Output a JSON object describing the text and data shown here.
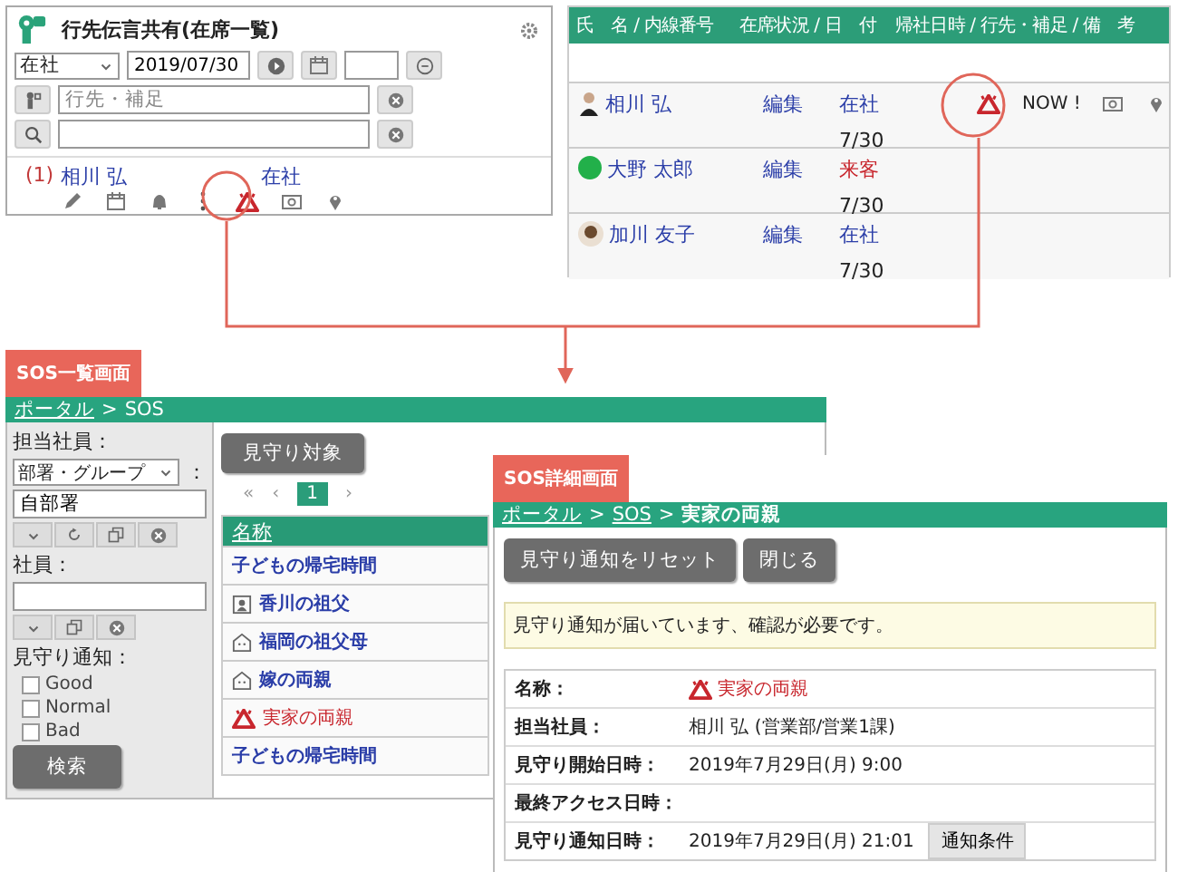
{
  "presence_widget": {
    "title": "行先伝言共有(在席一覧)",
    "status_select": "在社",
    "date": "2019/07/30",
    "note_placeholder": "行先・補足",
    "entry": {
      "count": "(1)",
      "name": "相川 弘",
      "status": "在社"
    }
  },
  "presence_table": {
    "columns": [
      "氏　名 / 内線番号",
      "在席状況 / 日　付",
      "帰社日時 / 行先・補足 / 備　考"
    ],
    "rows": [
      {
        "name": "相川 弘",
        "avatar": {
          "kind": "suit"
        },
        "edit": "編集",
        "status": "在社",
        "kind": "present",
        "date": "7/30",
        "alert": true,
        "note": "NOW !"
      },
      {
        "name": "大野 太郎",
        "avatar": {
          "kind": "dot",
          "color": "#22b04a"
        },
        "edit": "編集",
        "status": "来客",
        "kind": "visitor",
        "date": "7/30",
        "alert": false
      },
      {
        "name": "加川 友子",
        "avatar": {
          "kind": "face"
        },
        "edit": "編集",
        "status": "在社",
        "kind": "present",
        "date": "7/30",
        "alert": false
      }
    ]
  },
  "sos_list": {
    "tab_label": "SOS一覧画面",
    "breadcrumb": [
      {
        "label": "ポータル",
        "link": true
      },
      {
        "label": ">",
        "link": false
      },
      {
        "label": "SOS",
        "link": false
      }
    ],
    "filters": {
      "staff_label": "担当社員：",
      "group_select": "部署・グループ",
      "group_colon": "：",
      "group_value": "自部署",
      "employee_label": "社員：",
      "watch_label": "見守り通知：",
      "options": [
        {
          "label": "Good",
          "checked": false
        },
        {
          "label": "Normal",
          "checked": false
        },
        {
          "label": "Bad",
          "checked": false
        }
      ],
      "search_button": "検索"
    },
    "target_button": "見守り対象",
    "pagination": {
      "first": "«",
      "prev": "‹",
      "pages": [
        {
          "label": "1",
          "selected": true
        }
      ],
      "next": "›"
    },
    "table": {
      "column": "名称",
      "rows": [
        {
          "label": "子どもの帰宅時間",
          "kind": "plain"
        },
        {
          "label": "香川の祖父",
          "kind": "person"
        },
        {
          "label": "福岡の祖父母",
          "kind": "house"
        },
        {
          "label": "嫁の両親",
          "kind": "house"
        },
        {
          "label": "実家の両親",
          "kind": "alert"
        },
        {
          "label": "子どもの帰宅時間",
          "kind": "plain"
        }
      ]
    }
  },
  "sos_detail": {
    "tab_label": "SOS詳細画面",
    "breadcrumb": [
      {
        "label": "ポータル",
        "link": true
      },
      {
        "label": ">",
        "link": false
      },
      {
        "label": "SOS",
        "link": true
      },
      {
        "label": ">",
        "link": false
      },
      {
        "label": "実家の両親",
        "link": false,
        "bold": true
      }
    ],
    "buttons": [
      "見守り通知をリセット",
      "閉じる"
    ],
    "notice": "見守り通知が届いています、確認が必要です。",
    "fields": [
      {
        "label": "名称：",
        "kind": "alert",
        "value": "実家の両親"
      },
      {
        "label": "担当社員：",
        "kind": "text",
        "value": "相川 弘 (営業部/営業1課)"
      },
      {
        "label": "見守り開始日時：",
        "kind": "text",
        "value": "2019年7月29日(月) 9:00"
      },
      {
        "label": "最終アクセス日時：",
        "kind": "empty"
      },
      {
        "label": "見守り通知日時：",
        "kind": "button",
        "value": "2019年7月29日(月) 21:01",
        "button": "通知条件"
      }
    ]
  }
}
